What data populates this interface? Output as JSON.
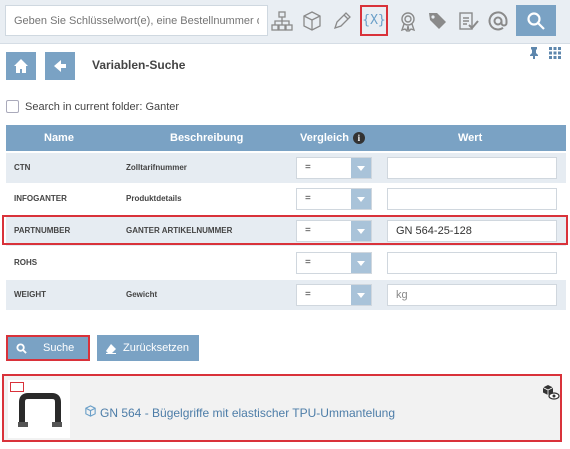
{
  "topbar": {
    "search_placeholder": "Geben Sie Schlüsselwort(e), eine Bestellnummer oder",
    "icons": [
      "hierarchy-icon",
      "cube-icon",
      "pencil-icon",
      "variable-icon",
      "badge-icon",
      "tags-icon",
      "clipboard-check-icon",
      "at-icon",
      "search-icon"
    ],
    "variable_label": "{X}"
  },
  "header": {
    "title": "Variablen-Suche"
  },
  "folder_search": {
    "label": "Search in current folder: Ganter",
    "checked": false
  },
  "table": {
    "columns": [
      "Name",
      "Beschreibung",
      "Vergleich",
      "Wert"
    ],
    "rows": [
      {
        "name": "CTN",
        "description": "Zolltarifnummer",
        "compare": "=",
        "value": "",
        "placeholder": ""
      },
      {
        "name": "INFOGANTER",
        "description": "Produktdetails",
        "compare": "=",
        "value": "",
        "placeholder": ""
      },
      {
        "name": "PARTNUMBER",
        "description": "GANTER ARTIKELNUMMER",
        "compare": "=",
        "value": "GN 564-25-128",
        "placeholder": ""
      },
      {
        "name": "ROHS",
        "description": "",
        "compare": "=",
        "value": "",
        "placeholder": ""
      },
      {
        "name": "WEIGHT",
        "description": "Gewicht",
        "compare": "=",
        "value": "",
        "placeholder": "kg"
      }
    ]
  },
  "actions": {
    "search_label": "Suche",
    "reset_label": "Zurücksetzen"
  },
  "result": {
    "title": "GN 564 - Bügelgriffe mit elastischer TPU-Ummantelung"
  },
  "colors": {
    "accent": "#7aa2c4",
    "highlight": "#d9323a",
    "link": "#4d7da8"
  }
}
